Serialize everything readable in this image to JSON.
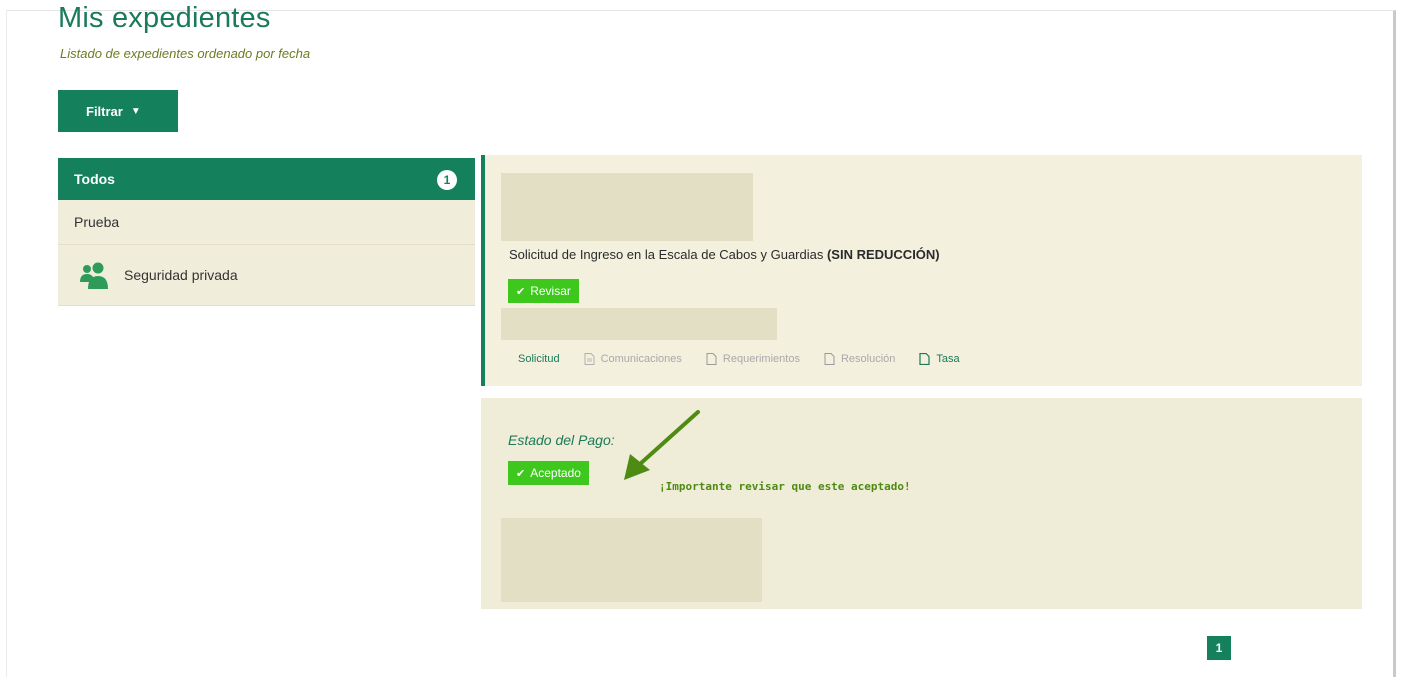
{
  "header": {
    "title": "Mis expedientes",
    "subtitle": "Listado de expedientes ordenado por fecha"
  },
  "filter": {
    "label": "Filtrar",
    "icon": "caret-down-icon"
  },
  "sidebar": {
    "active": {
      "label": "Todos",
      "count": "1"
    },
    "items": [
      {
        "label": "Prueba"
      },
      {
        "label": "Seguridad privada",
        "icon": "people-icon"
      }
    ]
  },
  "expediente": {
    "title_text": "Solicitud de Ingreso en la Escala de Cabos y Guardias ",
    "title_bold": "(SIN REDUCCIÓN)",
    "status_label": "Revisar",
    "links": [
      {
        "label": "Solicitud"
      },
      {
        "label": "Comunicaciones"
      },
      {
        "label": "Requerimientos"
      },
      {
        "label": "Resolución"
      },
      {
        "label": "Tasa"
      }
    ]
  },
  "pago": {
    "label": "Estado del Pago:",
    "status_label": "Aceptado",
    "annotation": "¡Importante revisar que este aceptado!"
  },
  "pagination": {
    "current": "1"
  },
  "colors": {
    "primary": "#14805c",
    "accent_green": "#3ec81e",
    "card_bg": "#f3f0de",
    "placeholder": "#e3dfc4"
  }
}
